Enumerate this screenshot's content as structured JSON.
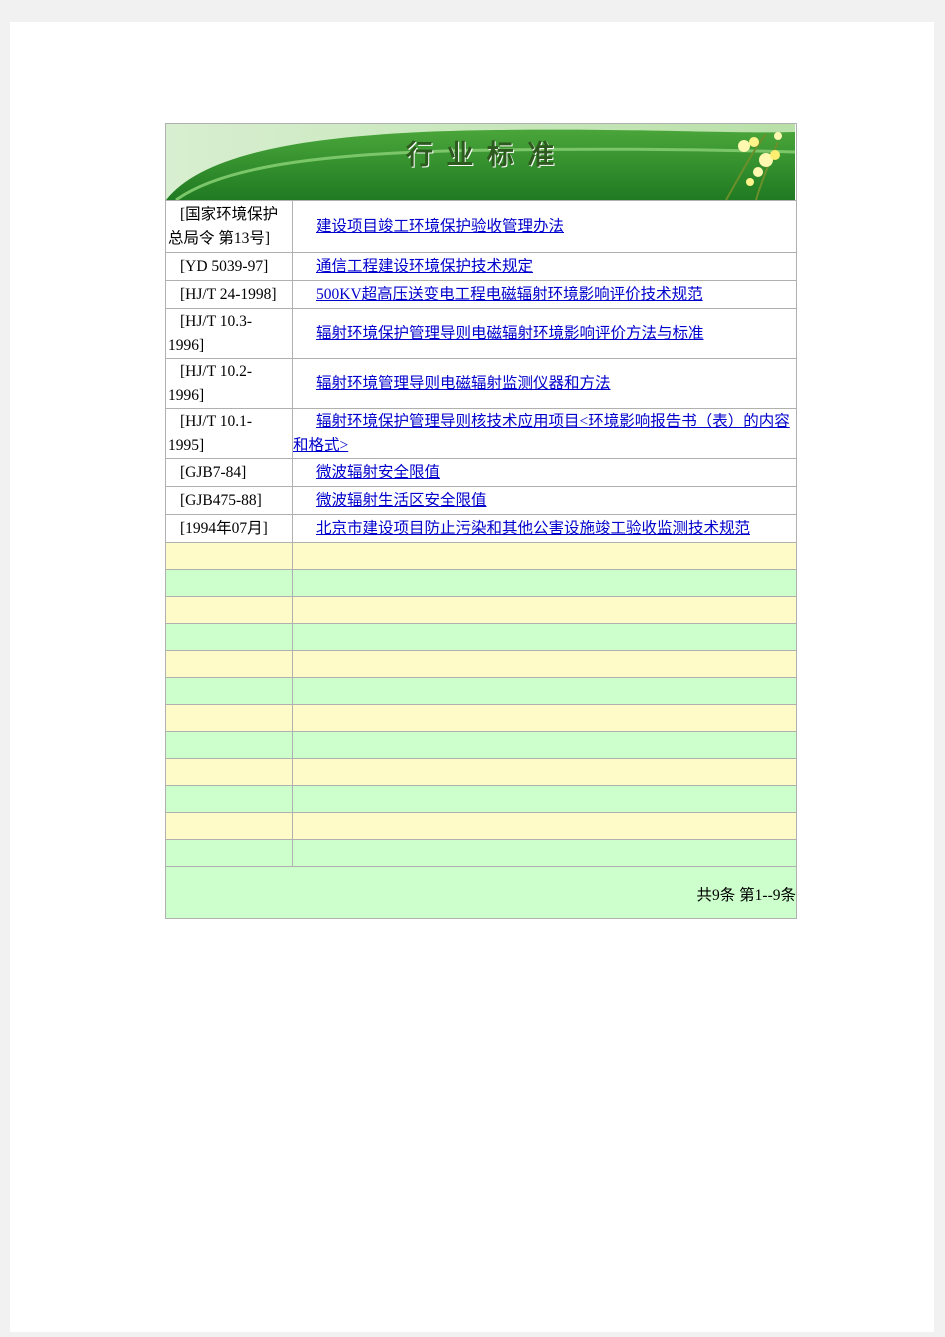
{
  "banner": {
    "title": "行 业 标 准"
  },
  "standards": [
    {
      "code": "[国家环境保护总局令 第13号]",
      "title": "建设项目竣工环境保护验收管理办法"
    },
    {
      "code": "[YD 5039-97]",
      "title": "通信工程建设环境保护技术规定"
    },
    {
      "code": "[HJ/T 24-1998]",
      "title": "500KV超高压送变电工程电磁辐射环境影响评价技术规范"
    },
    {
      "code": "[HJ/T 10.3-1996]",
      "title": "辐射环境保护管理导则电磁辐射环境影响评价方法与标准"
    },
    {
      "code": "[HJ/T 10.2-1996]",
      "title": "辐射环境管理导则电磁辐射监测仪器和方法"
    },
    {
      "code": "[HJ/T 10.1-1995]",
      "title": "辐射环境保护管理导则核技术应用项目<环境影响报告书（表）的内容和格式>"
    },
    {
      "code": "[GJB7-84]",
      "title": "微波辐射安全限值"
    },
    {
      "code": "[GJB475-88]",
      "title": "微波辐射生活区安全限值"
    },
    {
      "code": "[1994年07月]",
      "title": "北京市建设项目防止污染和其他公害设施竣工验收监测技术规范"
    }
  ],
  "footer": {
    "summary": "共9条 第1--9条"
  }
}
